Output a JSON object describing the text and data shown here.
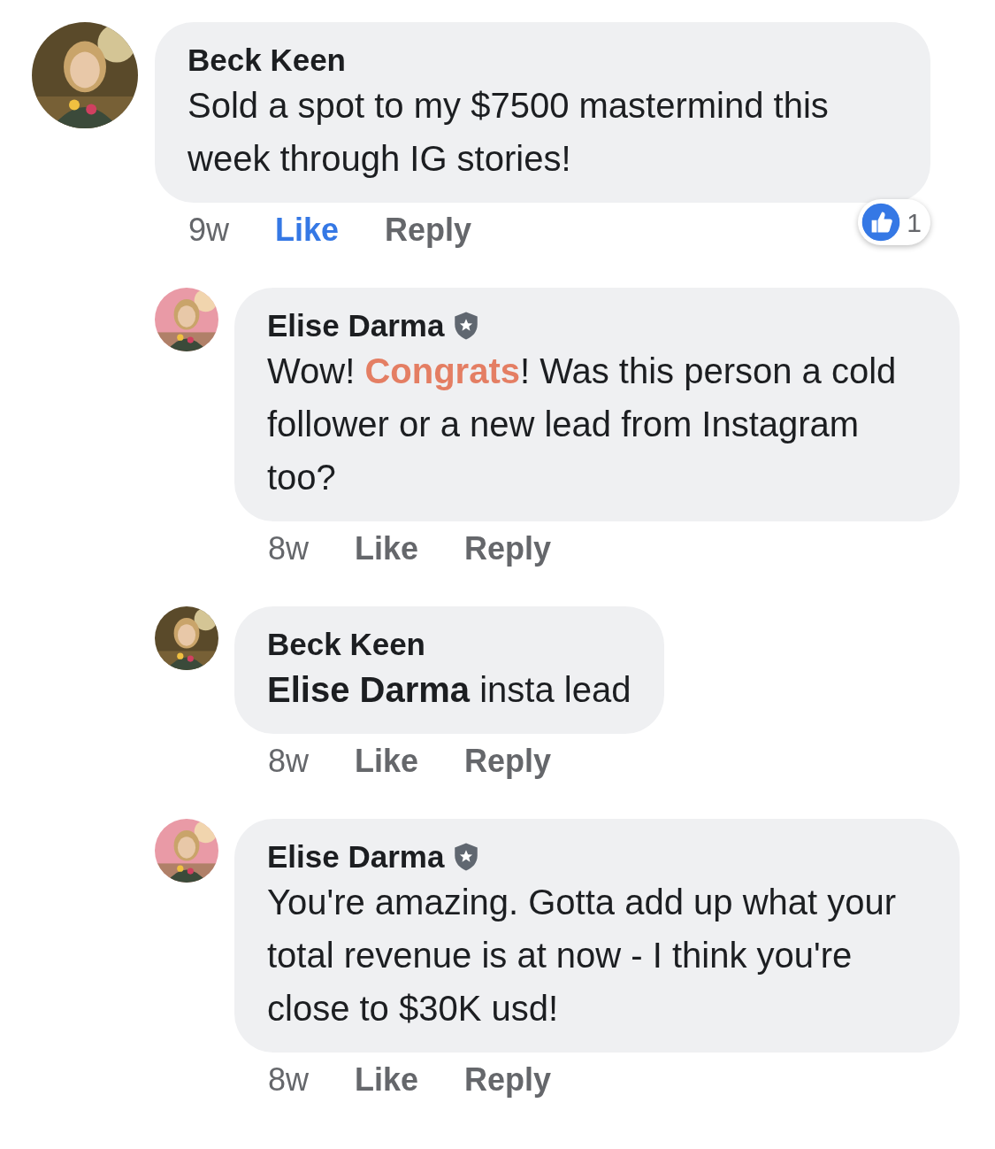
{
  "comments": [
    {
      "author": "Beck Keen",
      "verified": false,
      "segments": [
        {
          "kind": "plain",
          "text": "Sold a spot to my $7500 mastermind this week through IG stories!"
        }
      ],
      "time": "9w",
      "like": {
        "label": "Like",
        "selected": true
      },
      "reply": "Reply",
      "reactions": {
        "count": "1"
      },
      "children": [
        {
          "author": "Elise Darma",
          "verified": true,
          "segments": [
            {
              "kind": "plain",
              "text": "Wow! "
            },
            {
              "kind": "highlight",
              "text": "Congrats"
            },
            {
              "kind": "plain",
              "text": "! Was this person a cold follower or a new lead from Instagram too?"
            }
          ],
          "time": "8w",
          "like": {
            "label": "Like",
            "selected": false
          },
          "reply": "Reply"
        },
        {
          "author": "Beck Keen",
          "verified": false,
          "segments": [
            {
              "kind": "mention",
              "text": "Elise Darma"
            },
            {
              "kind": "plain",
              "text": " insta lead"
            }
          ],
          "time": "8w",
          "like": {
            "label": "Like",
            "selected": false
          },
          "reply": "Reply"
        },
        {
          "author": "Elise Darma",
          "verified": true,
          "segments": [
            {
              "kind": "plain",
              "text": "You're amazing. Gotta add up what your total revenue is at now - I think you're close to $30K usd!"
            }
          ],
          "time": "8w",
          "like": {
            "label": "Like",
            "selected": false
          },
          "reply": "Reply"
        }
      ]
    }
  ]
}
